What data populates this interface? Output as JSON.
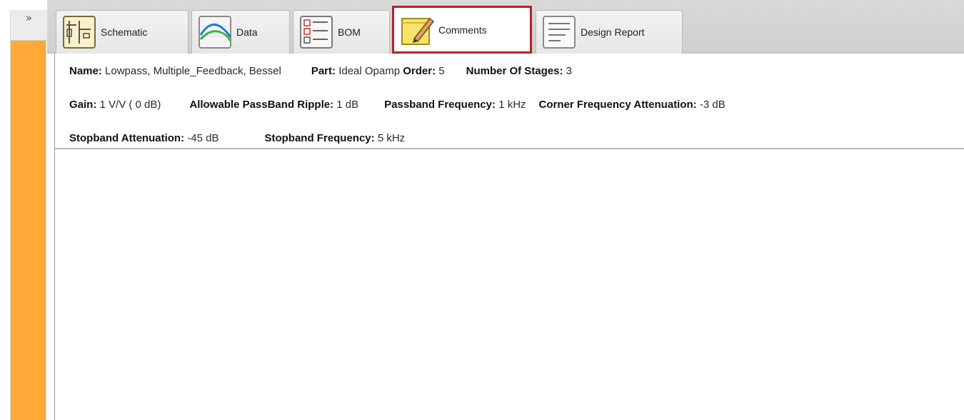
{
  "sidepanel": {
    "expand_glyph": "»",
    "accent_color": "#ffa938"
  },
  "tabs": [
    {
      "label": "Schematic",
      "icon": "schematic-icon"
    },
    {
      "label": "Data",
      "icon": "data-curve-icon"
    },
    {
      "label": "BOM",
      "icon": "bom-list-icon"
    },
    {
      "label": "Comments",
      "icon": "notepad-pencil-icon",
      "active": true
    },
    {
      "label": "Design Report",
      "icon": "document-report-icon"
    }
  ],
  "design": {
    "name_label": "Name:",
    "name_value": "Lowpass, Multiple_Feedback, Bessel",
    "part_label": "Part:",
    "part_value": "Ideal Opamp",
    "order_label": "Order:",
    "order_value": "5",
    "stages_label": "Number Of Stages:",
    "stages_value": "3",
    "gain_label": "Gain:",
    "gain_value": "1 V/V ( 0 dB)",
    "ripple_label": "Allowable PassBand Ripple:",
    "ripple_value": "1 dB",
    "passband_label": "Passband Frequency:",
    "passband_value": "1 kHz",
    "corner_label": "Corner Frequency Attenuation:",
    "corner_value": "-3 dB",
    "stopatt_label": "Stopband Attenuation:",
    "stopatt_value": "-45 dB",
    "stopfreq_label": "Stopband Frequency:",
    "stopfreq_value": "5 kHz"
  },
  "colors": {
    "active_tab_border": "#b5202b",
    "tabstrip": "#d4d4d4"
  }
}
